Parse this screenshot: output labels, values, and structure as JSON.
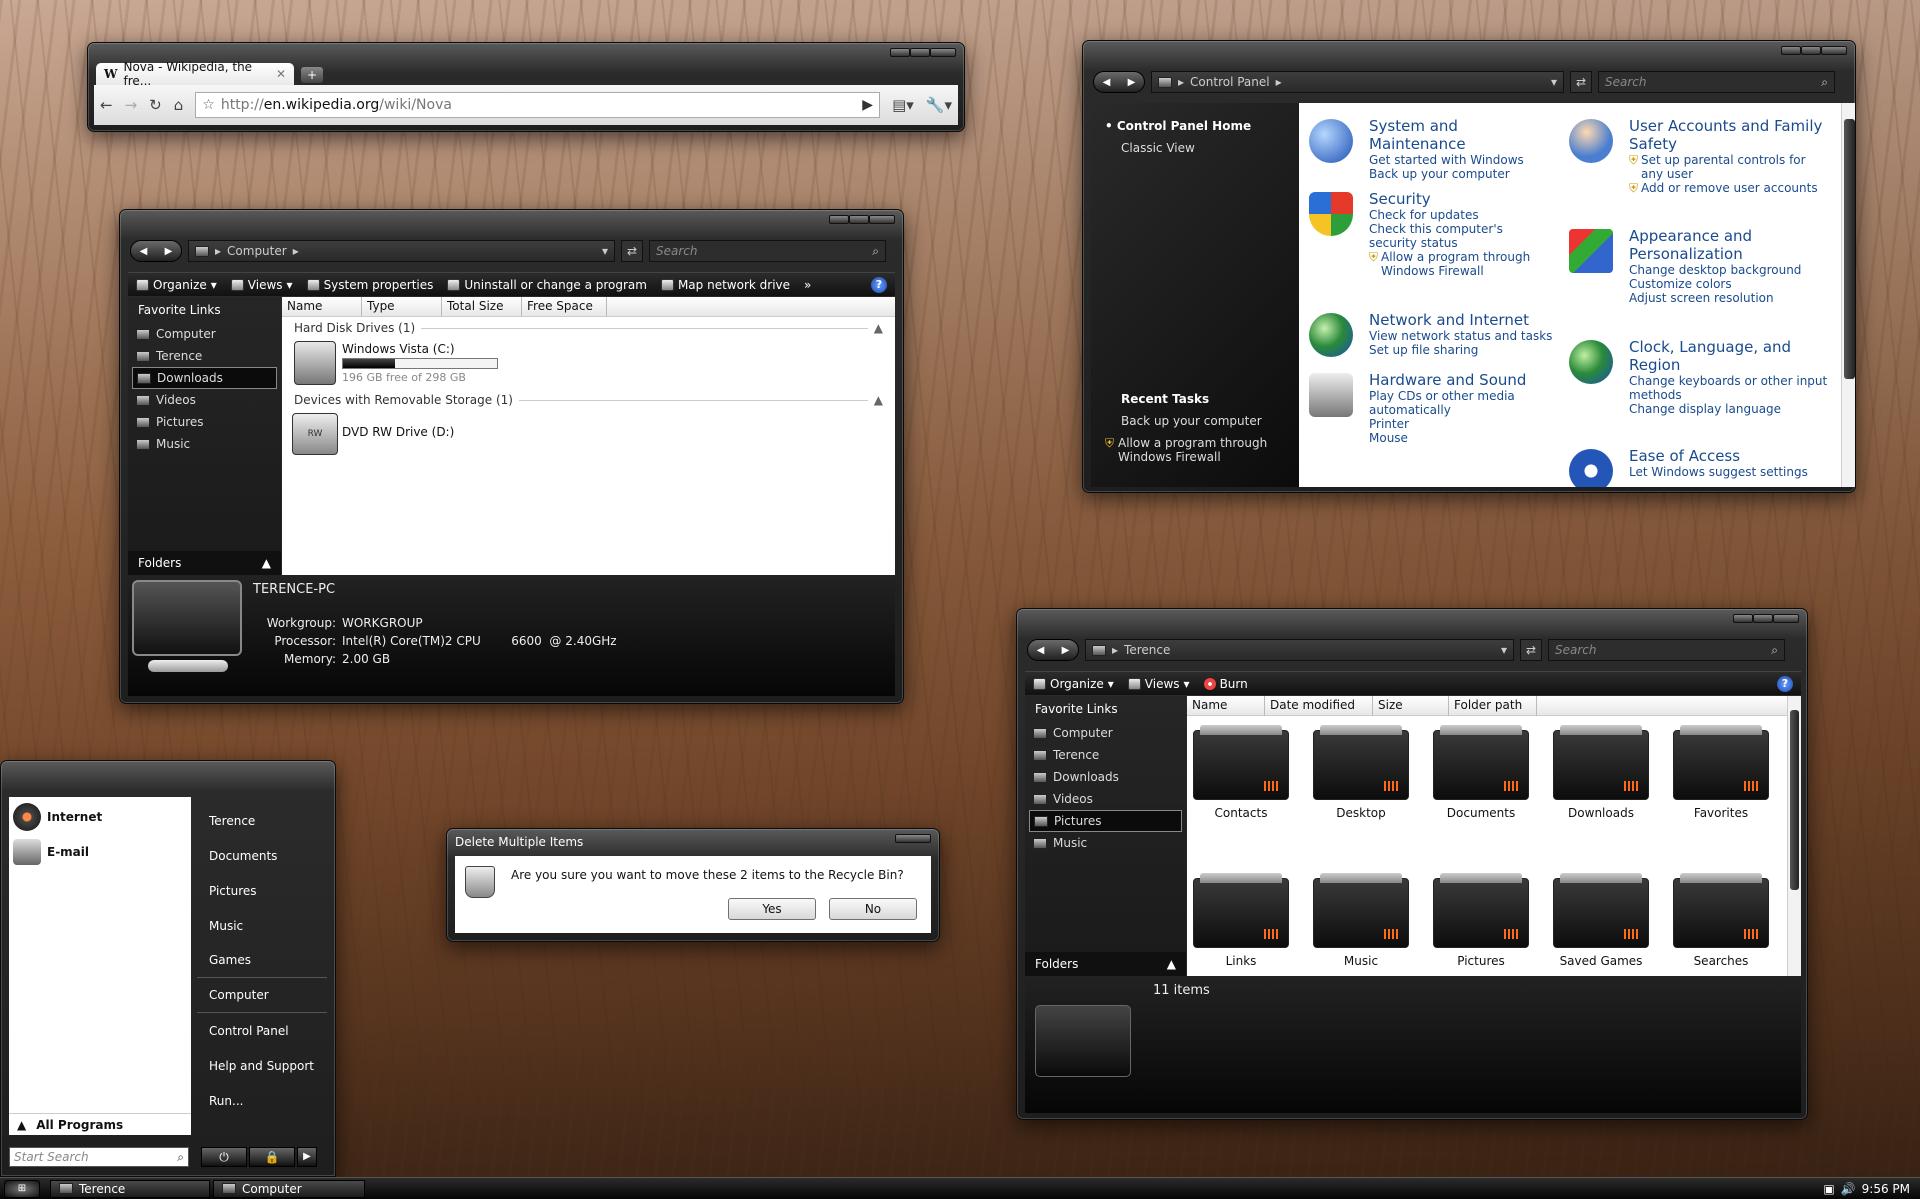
{
  "browser": {
    "tab_title": "Nova - Wikipedia, the fre...",
    "new_tab": "+",
    "url_prefix": "http://",
    "url_host": "en.wikipedia.org",
    "url_path": "/wiki/Nova"
  },
  "computer": {
    "path": "Computer",
    "search": "Search",
    "toolbar": [
      "Organize",
      "Views",
      "System properties",
      "Uninstall or change a program",
      "Map network drive",
      "»"
    ],
    "favorites_title": "Favorite Links",
    "favorites": [
      "Computer",
      "Terence",
      "Downloads",
      "Videos",
      "Pictures",
      "Music"
    ],
    "selected": "Downloads",
    "folders_label": "Folders",
    "columns": [
      "Name",
      "Type",
      "Total Size",
      "Free Space"
    ],
    "group1": "Hard Disk Drives (1)",
    "drive_c": "Windows Vista (C:)",
    "drive_c_free": "196 GB free of 298 GB",
    "drive_c_used_fraction": 0.34,
    "group2": "Devices with Removable Storage (1)",
    "drive_d": "DVD RW Drive (D:)",
    "drive_d_icon_text": "RW",
    "pc_name": "TERENCE-PC",
    "details": [
      {
        "k": "Workgroup:",
        "v": "WORKGROUP"
      },
      {
        "k": "Processor:",
        "v": "Intel(R) Core(TM)2 CPU        6600  @ 2.40GHz"
      },
      {
        "k": "Memory:",
        "v": "2.00 GB"
      }
    ]
  },
  "control_panel": {
    "path": "Control Panel",
    "search": "Search",
    "home": "Control Panel Home",
    "classic": "Classic View",
    "recent_title": "Recent Tasks",
    "recent": [
      "Back up your computer",
      "Allow a program through Windows Firewall"
    ],
    "left_cats": [
      {
        "title": "System and Maintenance",
        "links": [
          "Get started with Windows",
          "Back up your computer"
        ]
      },
      {
        "title": "Security",
        "links": [
          "Check for updates",
          "Check this computer's security status",
          "Allow a program through Windows Firewall"
        ]
      },
      {
        "title": "Network and Internet",
        "links": [
          "View network status and tasks",
          "Set up file sharing"
        ]
      },
      {
        "title": "Hardware and Sound",
        "links": [
          "Play CDs or other media automatically",
          "Printer",
          "Mouse"
        ]
      }
    ],
    "right_cats": [
      {
        "title": "User Accounts and Family Safety",
        "links": [
          "Set up parental controls for any user",
          "Add or remove user accounts"
        ]
      },
      {
        "title": "Appearance and Personalization",
        "links": [
          "Change desktop background",
          "Customize colors",
          "Adjust screen resolution"
        ]
      },
      {
        "title": "Clock, Language, and Region",
        "links": [
          "Change keyboards or other input methods",
          "Change display language"
        ]
      },
      {
        "title": "Ease of Access",
        "links": [
          "Let Windows suggest settings"
        ]
      }
    ]
  },
  "terence": {
    "path": "Terence",
    "search": "Search",
    "toolbar": [
      "Organize",
      "Views",
      "Burn"
    ],
    "favorites_title": "Favorite Links",
    "favorites": [
      "Computer",
      "Terence",
      "Downloads",
      "Videos",
      "Pictures",
      "Music"
    ],
    "selected": "Pictures",
    "folders_label": "Folders",
    "columns": [
      "Name",
      "Date modified",
      "Size",
      "Folder path"
    ],
    "items": [
      "Contacts",
      "Desktop",
      "Documents",
      "Downloads",
      "Favorites",
      "Links",
      "Music",
      "Pictures",
      "Saved Games",
      "Searches"
    ],
    "count": "11 items"
  },
  "dialog": {
    "title": "Delete Multiple Items",
    "message": "Are you sure you want to move these 2 items to the Recycle Bin?",
    "yes": "Yes",
    "no": "No"
  },
  "start_menu": {
    "pinned": [
      "Internet",
      "E-mail"
    ],
    "all_programs": "All Programs",
    "search": "Start Search",
    "right": [
      "Terence",
      "Documents",
      "Pictures",
      "Music",
      "Games",
      "Computer",
      "Control Panel",
      "Help and Support",
      "Run..."
    ]
  },
  "taskbar": {
    "items": [
      "Terence",
      "Computer"
    ],
    "clock": "9:56 PM"
  }
}
